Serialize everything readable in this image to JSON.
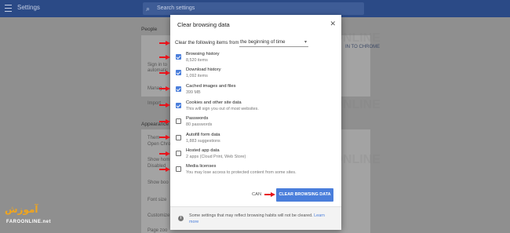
{
  "header": {
    "title": "Settings",
    "search_placeholder": "Search settings"
  },
  "background": {
    "people_heading": "People",
    "sign_in": "Sign in to",
    "sign_in_sub": "automatic",
    "manage": "Manag",
    "import": "Import",
    "appearance_heading": "Appearance",
    "themes": "Them",
    "themes_sub": "Open Chrom",
    "show_home": "Show hom",
    "show_home_sub": "Disabled",
    "show_bookmarks": "Show boo",
    "font_size": "Font size",
    "customize": "Customize",
    "page_zoom": "Page zoo",
    "sign_in_chrome": "IN TO CHROME"
  },
  "dialog": {
    "title": "Clear browsing data",
    "close_label": "✕",
    "range_label": "Clear the following items from",
    "range_value": "the beginning of time",
    "options": [
      {
        "title": "Browsing history",
        "sub": "8,520 items",
        "checked": true
      },
      {
        "title": "Download history",
        "sub": "1,092 items",
        "checked": true
      },
      {
        "title": "Cached images and files",
        "sub": "399 MB",
        "checked": true
      },
      {
        "title": "Cookies and other site data",
        "sub": "This will sign you out of most websites.",
        "checked": true
      },
      {
        "title": "Passwords",
        "sub": "80 passwords",
        "checked": false
      },
      {
        "title": "Autofill form data",
        "sub": "1,883 suggestions",
        "checked": false
      },
      {
        "title": "Hosted app data",
        "sub": "2 apps (Cloud Print, Web Store)",
        "checked": false
      },
      {
        "title": "Media licenses",
        "sub": "You may lose access to protected content from some sites.",
        "checked": false
      }
    ],
    "cancel_label": "CAN",
    "clear_label": "CLEAR BROWSING DATA",
    "footer_text": "Some settings that may reflect browsing habits will not be cleared.",
    "footer_link": "Learn more"
  },
  "logo": {
    "main": "آموزش",
    "sub": "FAROONLINE.net"
  },
  "colors": {
    "accent": "#4a7edb",
    "annotation_arrow": "#e8141c",
    "topbar": "#2b4a86"
  }
}
